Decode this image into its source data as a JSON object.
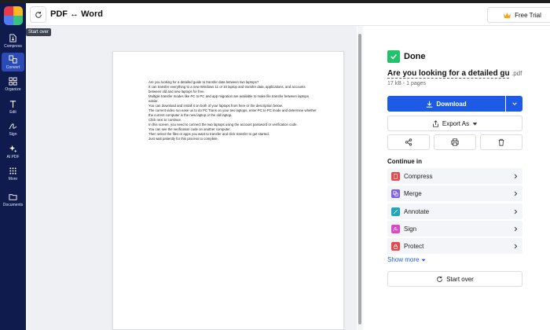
{
  "app": {
    "title": "PDF ↔ Word",
    "free_trial_label": "Free Trial",
    "tooltip": "Start over",
    "accent_color": "#1d5ae6",
    "sidebar_color": "#0f1b4d"
  },
  "sidebar": {
    "items": [
      {
        "label": "Compress",
        "icon": "compress-icon"
      },
      {
        "label": "Convert",
        "icon": "convert-icon",
        "active": true
      },
      {
        "label": "Organize",
        "icon": "organize-icon"
      },
      {
        "label": "Edit",
        "icon": "edit-text-icon"
      },
      {
        "label": "Sign",
        "icon": "sign-icon"
      },
      {
        "label": "AI PDF",
        "icon": "sparkle-icon"
      },
      {
        "label": "More",
        "icon": "grid-icon"
      },
      {
        "label": "Documents",
        "icon": "folder-icon"
      }
    ]
  },
  "document": {
    "lines": [
      "Are you looking for a detailed guide to transfer data between two laptops?",
      "It can transfer everything to a new Windows 11 or 10 laptop and transfer data, applications, and accounts between old and new laptops for free.",
      "Multiple transfer modes like PC to PC and app migration are available to make file transfer between laptops easier.",
      "You can download and install it on both of your laptops from here or the description below.",
      "The current video run ease us to do PC Trans on your two laptops, enter PC to PC mode and determine whether the current computer is the new laptop or the old laptop.",
      "Click next to continue.",
      "In this screen, you need to connect the two laptops using the account password or verification code.",
      "You can see the verification code on another computer.",
      "Then select the files or apps you want to transfer and click transfer to get started.",
      "Just wait patiently for this process to complete."
    ]
  },
  "result": {
    "status": "Done",
    "filename": "Are you looking for a detailed guide ...",
    "extension": ".pdf",
    "meta": "17 kB - 1 pages",
    "download_label": "Download",
    "export_label": "Export As",
    "continue_label": "Continue in",
    "tools": [
      {
        "label": "Compress",
        "icon": "compress-tool-icon",
        "color": "#e5484d"
      },
      {
        "label": "Merge",
        "icon": "merge-tool-icon",
        "color": "#7b61e8"
      },
      {
        "label": "Annotate",
        "icon": "annotate-tool-icon",
        "color": "#1ba8b8"
      },
      {
        "label": "Sign",
        "icon": "sign-tool-icon",
        "color": "#d94ac9"
      },
      {
        "label": "Protect",
        "icon": "protect-tool-icon",
        "color": "#e5484d"
      }
    ],
    "show_more_label": "Show more",
    "start_over_label": "Start over"
  }
}
